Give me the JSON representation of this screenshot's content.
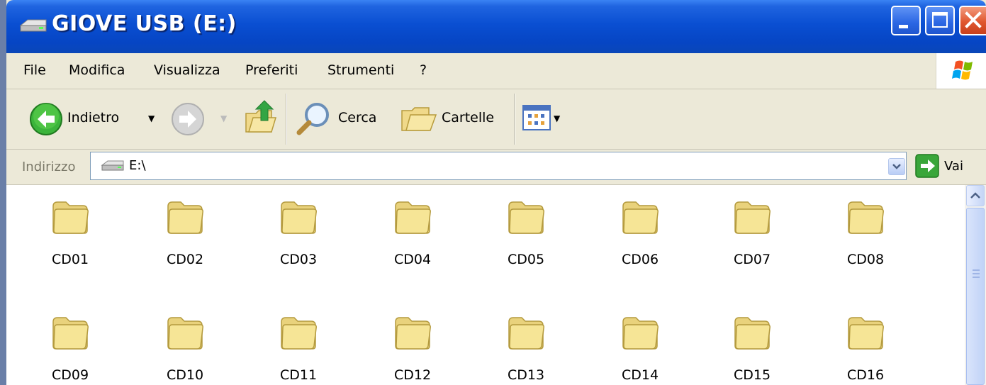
{
  "window": {
    "title": "GIOVE USB (E:)"
  },
  "menu": {
    "items": [
      "File",
      "Modifica",
      "Visualizza",
      "Preferiti",
      "Strumenti",
      "?"
    ]
  },
  "toolbar": {
    "back_label": "Indietro",
    "search_label": "Cerca",
    "folders_label": "Cartelle"
  },
  "address": {
    "label": "Indirizzo",
    "value": "E:\\",
    "go_label": "Vai"
  },
  "folders": [
    "CD01",
    "CD02",
    "CD03",
    "CD04",
    "CD05",
    "CD06",
    "CD07",
    "CD08",
    "CD09",
    "CD10",
    "CD11",
    "CD12",
    "CD13",
    "CD14",
    "CD15",
    "CD16"
  ],
  "colors": {
    "titlebar": "#0645c4",
    "chrome": "#ece9d8",
    "folder": "#f6e596",
    "close": "#e0572f"
  }
}
